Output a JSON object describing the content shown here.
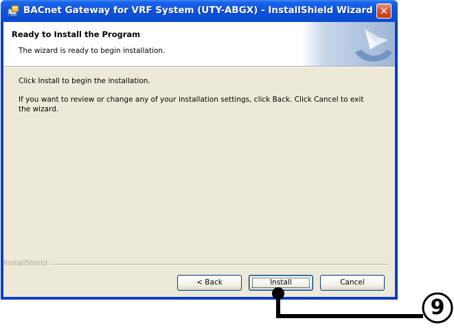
{
  "window": {
    "title": "BACnet Gateway for VRF System (UTY-ABGX) - InstallShield Wizard",
    "close_symbol": "✕"
  },
  "banner": {
    "title": "Ready to Install the Program",
    "subtitle": "The wizard is ready to begin installation."
  },
  "body": {
    "line1": "Click Install to begin the installation.",
    "line2": "If you want to review or change any of your installation settings, click Back. Click Cancel to exit the wizard."
  },
  "footer": {
    "brand_label": "InstallShield"
  },
  "buttons": {
    "back": "< Back",
    "install": "Install",
    "cancel": "Cancel"
  },
  "callout": {
    "number": "9"
  },
  "colors": {
    "titlebar": "#0a4fd8",
    "dialog_bg": "#ece9d8",
    "close_red": "#d9542f"
  }
}
